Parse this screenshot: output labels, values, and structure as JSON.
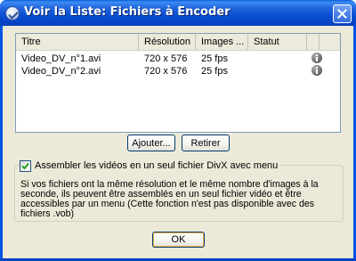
{
  "window": {
    "title": "Voir la Liste: Fichiers à Encoder"
  },
  "list": {
    "columns": [
      "Titre",
      "Résolution",
      "Images ...",
      "Statut",
      "",
      ""
    ],
    "rows": [
      {
        "title": "Video_DV_n°1.avi",
        "resolution": "720 x 576",
        "fps": "25 fps",
        "status": "",
        "icon": "info-icon"
      },
      {
        "title": "Video_DV_n°2.avi",
        "resolution": "720 x 576",
        "fps": "25 fps",
        "status": "",
        "icon": "info-icon"
      }
    ]
  },
  "buttons": {
    "add": "Ajouter...",
    "remove": "Retirer",
    "ok": "OK"
  },
  "group": {
    "checkbox_label": "Assembler les vidéos en un seul fichier DivX avec menu",
    "checked": true,
    "description": "Si vos fichiers ont la même résolution et le même nombre d'images à la seconde, ils peuvent être assemblés en un seul fichier vidéo et être accessibles par un menu (Cette fonction n'est pas disponible avec des fichiers .vob)"
  },
  "colors": {
    "titlebar": "#0054e3",
    "dialog_bg": "#ece9d8",
    "list_border": "#7f9db9",
    "button_border": "#003c74"
  }
}
